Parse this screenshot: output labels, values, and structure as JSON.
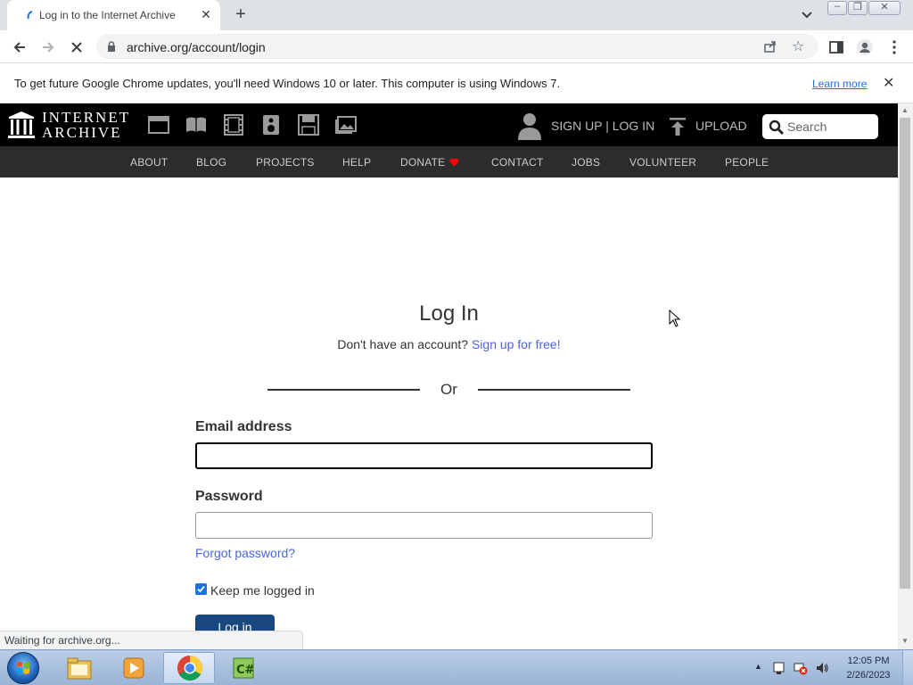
{
  "browser": {
    "tab_title": "Log in to the Internet Archive",
    "url": "archive.org/account/login",
    "infobar_message": "To get future Google Chrome updates, you'll need Windows 10 or later. This computer is using Windows 7.",
    "infobar_link": "Learn more",
    "status_text": "Waiting for archive.org..."
  },
  "ia_header": {
    "logo_line1": "INTERNET",
    "logo_line2": "ARCHIVE",
    "signup_login": "SIGN UP | LOG IN",
    "upload": "UPLOAD",
    "search_placeholder": "Search",
    "nav": [
      "ABOUT",
      "BLOG",
      "PROJECTS",
      "HELP",
      "DONATE",
      "CONTACT",
      "JOBS",
      "VOLUNTEER",
      "PEOPLE"
    ]
  },
  "login": {
    "title": "Log In",
    "no_account": "Don't have an account?",
    "signup_link": "Sign up for free!",
    "or": "Or",
    "email_label": "Email address",
    "email_value": "",
    "password_label": "Password",
    "password_value": "",
    "forgot": "Forgot password?",
    "keep_logged_in": "Keep me logged in",
    "keep_checked": true,
    "button": "Log in"
  },
  "taskbar": {
    "time": "12:05 PM",
    "date": "2/26/2023"
  },
  "colors": {
    "link": "#4b64de",
    "button": "#194880",
    "ia_header": "#000000",
    "ia_nav": "#2c2c2c"
  }
}
